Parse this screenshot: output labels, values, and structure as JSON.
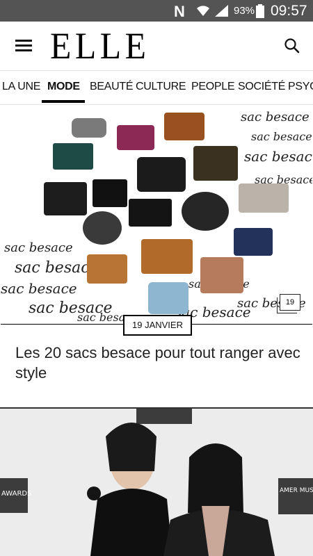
{
  "status_bar": {
    "carrier_glyph": "N",
    "battery": "93%",
    "time": "09:57"
  },
  "header": {
    "logo": "ELLE",
    "menu_icon": "hamburger-icon",
    "search_icon": "search-icon"
  },
  "nav": {
    "items": [
      {
        "label": "LA UNE"
      },
      {
        "label": "MODE"
      },
      {
        "label": "BEAUTÉ"
      },
      {
        "label": "CULTURE"
      },
      {
        "label": "PEOPLE"
      },
      {
        "label": "SOCIÉTÉ"
      },
      {
        "label": "PSYC"
      }
    ],
    "active": "MODE"
  },
  "articles": [
    {
      "date": "19 JANVIER",
      "gallery_count": "19",
      "title": "Les 20 sacs besace pour tout ranger avec style",
      "image_text": "sac besace"
    },
    {
      "logo_text_left": "AWARDS",
      "logo_text_right": "AMER MUSI AWARDS"
    }
  ],
  "colors": {
    "status_bar": "#545454",
    "text": "#111111",
    "accent": "#000000"
  }
}
